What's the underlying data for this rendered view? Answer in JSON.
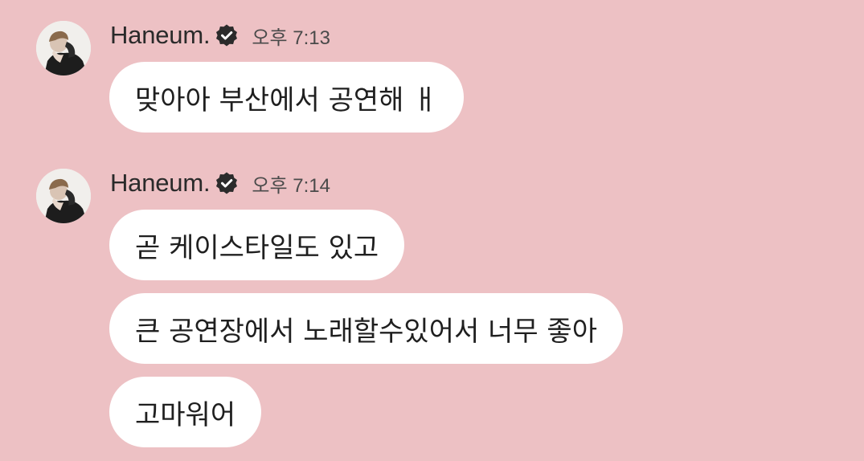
{
  "colors": {
    "background": "#edc1c4",
    "bubble": "#ffffff",
    "text": "#1f1f1f",
    "verified_badge": "#2b2b2b"
  },
  "messages": [
    {
      "sender": "Haneum.",
      "verified_icon": "verified-badge-icon",
      "time": "오후 7:13",
      "bubbles": [
        "맞아아 부산에서 공연해 ㅐ"
      ]
    },
    {
      "sender": "Haneum.",
      "verified_icon": "verified-badge-icon",
      "time": "오후 7:14",
      "bubbles": [
        "곧 케이스타일도 있고",
        "큰 공연장에서 노래할수있어서 너무 좋아",
        "고마워어"
      ]
    }
  ]
}
